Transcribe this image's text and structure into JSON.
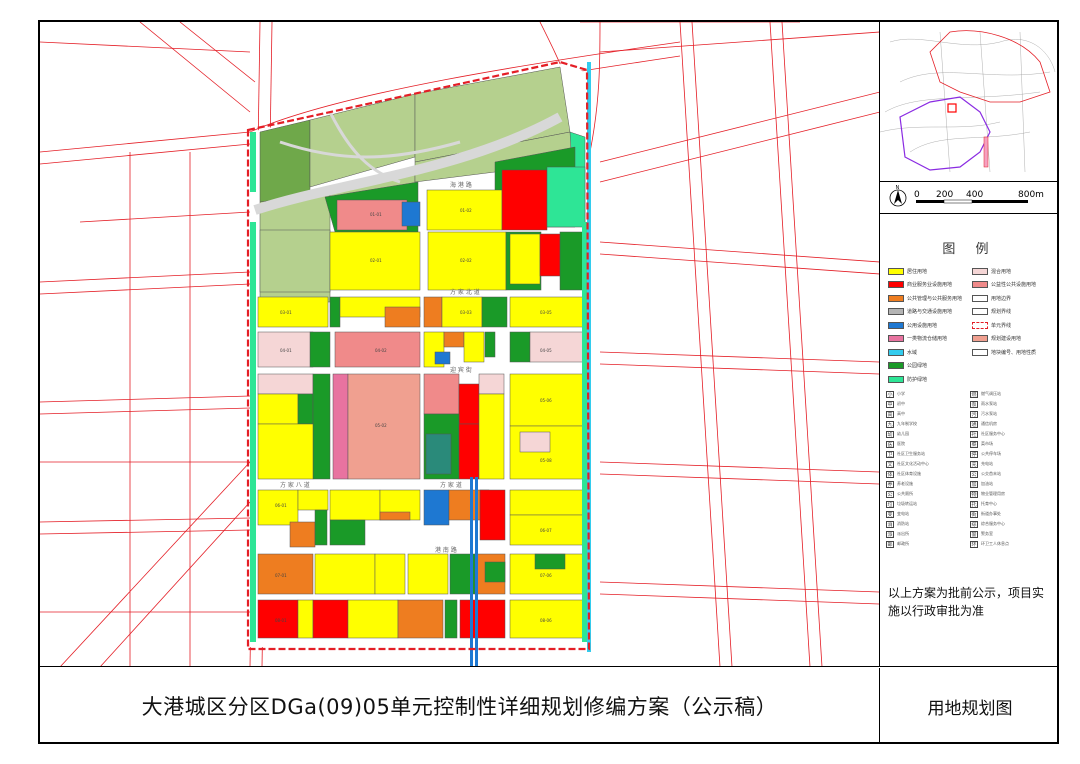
{
  "title": "大港城区分区DGa(09)05单元控制性详细规划修编方案（公示稿）",
  "map_type": "用地规划图",
  "note": "以上方案为批前公示，项目实施以行政审批为准",
  "scale": {
    "north": "N",
    "labels": [
      "0",
      "200",
      "400",
      "800m"
    ]
  },
  "legend": {
    "title": "图 例",
    "items": [
      {
        "label": "居住用地",
        "color": "#ffff00",
        "col": 0
      },
      {
        "label": "商业服务业设施用地",
        "color": "#ff0000",
        "col": 0
      },
      {
        "label": "公共管理与公共服务用地",
        "color": "#ee7d20",
        "col": 0
      },
      {
        "label": "道路与交通设施用地",
        "color": "#b4b4b4",
        "col": 0
      },
      {
        "label": "公用设施用地",
        "color": "#1e78d2",
        "col": 0
      },
      {
        "label": "一类物流仓储用地",
        "color": "#e873a0",
        "col": 0
      },
      {
        "label": "水域",
        "color": "#33ccee",
        "col": 0
      },
      {
        "label": "公园绿地",
        "color": "#1a9a28",
        "col": 0
      },
      {
        "label": "防护绿地",
        "color": "#2ee596",
        "col": 0
      },
      {
        "label": "混合用地",
        "color": "#f5d6d6",
        "col": 1
      },
      {
        "label": "公益性公共设施用地",
        "color": "#f08a8a",
        "col": 1
      },
      {
        "label": "用地边界",
        "color": "#ffffff",
        "col": 1
      },
      {
        "label": "规划界线",
        "color": "#ffffff",
        "col": 1
      },
      {
        "label": "单元界线",
        "color": "#ffffff",
        "col": 1
      },
      {
        "label": "规划建设用地",
        "color": "#f0a090",
        "col": 1
      },
      {
        "label": "地块编号、用地性质",
        "color": "#ffffff",
        "col": 1
      }
    ],
    "symbols": [
      {
        "icon": "小",
        "label": "小学"
      },
      {
        "icon": "中",
        "label": "初中"
      },
      {
        "icon": "高",
        "label": "高中"
      },
      {
        "icon": "九",
        "label": "九年制学校"
      },
      {
        "icon": "幼",
        "label": "幼儿园"
      },
      {
        "icon": "医",
        "label": "医院"
      },
      {
        "icon": "卫",
        "label": "社区卫生服务站"
      },
      {
        "icon": "文",
        "label": "社区文化活动中心"
      },
      {
        "icon": "体",
        "label": "社区体育设施"
      },
      {
        "icon": "养",
        "label": "养老设施"
      },
      {
        "icon": "公",
        "label": "公共厕所"
      },
      {
        "icon": "垃",
        "label": "垃圾转运站"
      },
      {
        "icon": "变",
        "label": "变电站"
      },
      {
        "icon": "消",
        "label": "消防站"
      },
      {
        "icon": "派",
        "label": "派出所"
      },
      {
        "icon": "邮",
        "label": "邮政所"
      },
      {
        "icon": "燃",
        "label": "燃气调压站"
      },
      {
        "icon": "泵",
        "label": "雨水泵站"
      },
      {
        "icon": "污",
        "label": "污水泵站"
      },
      {
        "icon": "通",
        "label": "通信机房"
      },
      {
        "icon": "社",
        "label": "社区服务中心"
      },
      {
        "icon": "菜",
        "label": "菜市场"
      },
      {
        "icon": "停",
        "label": "公共停车场"
      },
      {
        "icon": "充",
        "label": "充电站"
      },
      {
        "icon": "公",
        "label": "公交首末站"
      },
      {
        "icon": "加",
        "label": "加油站"
      },
      {
        "icon": "物",
        "label": "物业管理用房"
      },
      {
        "icon": "托",
        "label": "托育中心"
      },
      {
        "icon": "街",
        "label": "街道办事处"
      },
      {
        "icon": "综",
        "label": "综合服务中心"
      },
      {
        "icon": "警",
        "label": "警务室"
      },
      {
        "icon": "环",
        "label": "环卫工人休息点"
      }
    ]
  },
  "colors": {
    "residential": "#ffff00",
    "commercial": "#ff0000",
    "public": "#ee7d20",
    "road": "#b4b4b4",
    "utility": "#1e78d2",
    "logistics": "#e873a0",
    "water": "#33ccee",
    "park": "#1a9a28",
    "buffer": "#2ee596",
    "mixed": "#f5d6d6",
    "public_benefit": "#f08a8a",
    "outside_green": "#b5d08e",
    "boundary": "#e41e26"
  }
}
